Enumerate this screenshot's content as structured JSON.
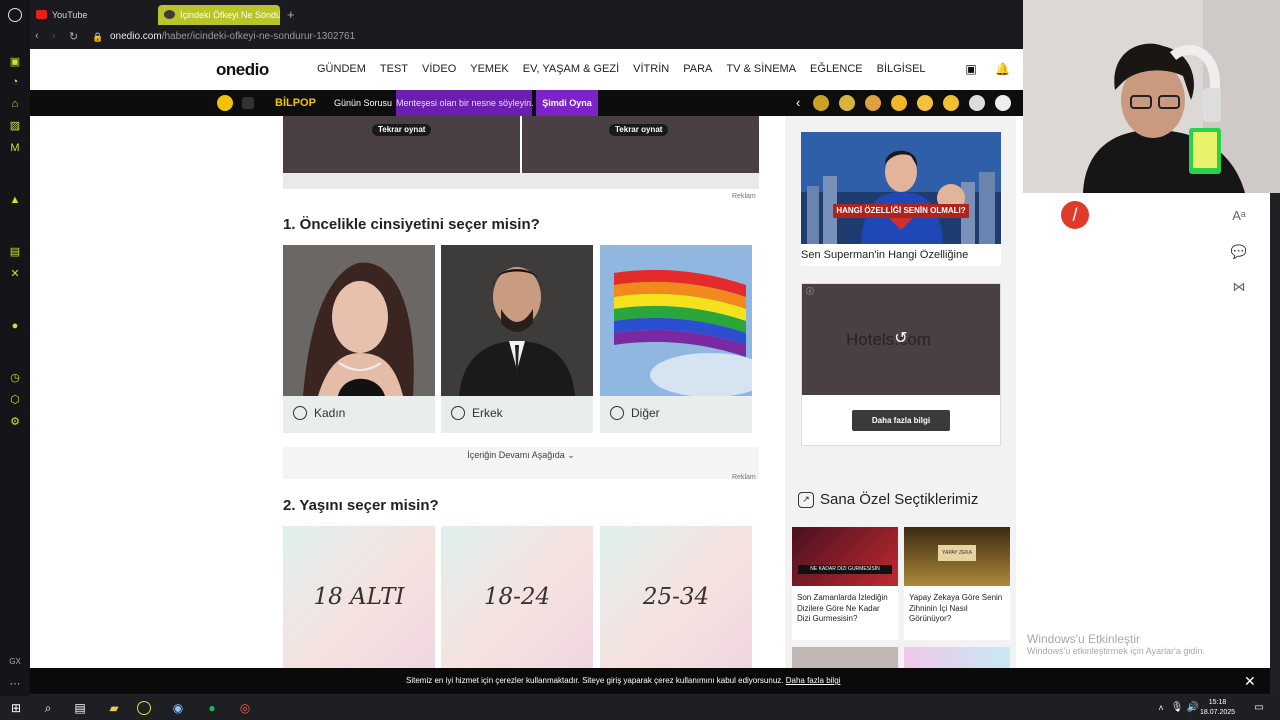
{
  "browser": {
    "tabs": [
      {
        "label": "YouTube"
      },
      {
        "label": "İçindeki Öfkeyi Ne Söndür"
      }
    ],
    "url_host": "onedio.com",
    "url_path": "/haber/icindeki-ofkeyi-ne-sondurur-1302761"
  },
  "site": {
    "logo": "onedio",
    "menu": [
      "GÜNDEM",
      "TEST",
      "VİDEO",
      "YEMEK",
      "EV, YAŞAM & GEZİ",
      "VİTRİN",
      "PARA",
      "TV & SİNEMA",
      "EĞLENCE",
      "BİLGİSEL"
    ]
  },
  "strip": {
    "bilpop": "BİLPOP",
    "gunun": "Günün Sorusu",
    "question": "Menteşesi olan bir nesne söyleyin.",
    "play": "Şimdi Oyna"
  },
  "video": {
    "replay1": "Tekrar oynat",
    "replay2": "Tekrar oynat",
    "reklam": "Reklam"
  },
  "q1": {
    "title": "1. Öncelikle cinsiyetini seçer misin?",
    "options": [
      "Kadın",
      "Erkek",
      "Diğer"
    ]
  },
  "devam": "İçeriğin Devamı Aşağıda",
  "reklam2": "Reklam",
  "q2": {
    "title": "2. Yaşını seçer misin?",
    "options": [
      "18 ALTI",
      "18-24",
      "25-34"
    ]
  },
  "ads": {
    "superman_banner": "HANGİ ÖZELLİĞİ SENİN OLMALI?",
    "superman_title": "Sen Superman'in Hangi Özelliğine",
    "hotels_brand": "Hotels.com",
    "hotels_button": "Daha fazla bilgi"
  },
  "sana": {
    "title": "Sana Özel Seçtiklerimiz",
    "items": [
      {
        "banner": "NE KADAR DİZİ GURMESİSİN",
        "text": "Son Zamanlarda İzlediğin Dizilere Göre Ne Kadar Dizi Gurmesisin?"
      },
      {
        "banner": "YAPAY ZEKA",
        "text": "Yapay Zekaya Göre Senin Zihninin İçi Nasıl Görünüyor?"
      }
    ]
  },
  "cookie": {
    "text": "Sitemiz en iyi hizmet için çerezler kullanmaktadır. Siteye giriş yaparak çerez kullanımını kabul ediyorsunuz.",
    "link": "Daha fazla bilgi"
  },
  "windows": {
    "activate_title": "Windows'u Etkinleştir",
    "activate_sub": "Windows'u etkinleştirmek için Ayarlar'a gidin.",
    "time": "15:18",
    "date": "18.07.2025"
  },
  "colors": {
    "accent": "#b8c42a",
    "purple": "#6a1fb0"
  }
}
